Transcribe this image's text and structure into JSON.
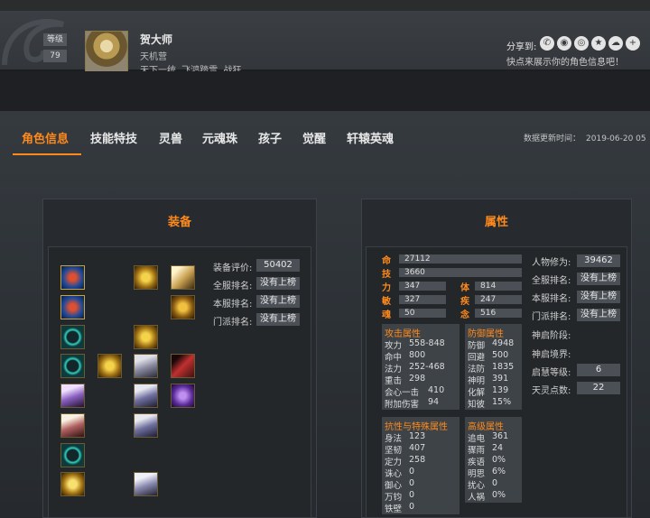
{
  "player": {
    "level_label": "等级",
    "level": "79",
    "name": "贺大师",
    "guild": "天机营",
    "title": "天下一统 飞鸿踏雪 战狂"
  },
  "share": {
    "label": "分享到",
    "subtitle": "快点来展示你的角色信息吧！",
    "icons": [
      "wechat-icon",
      "qq-icon",
      "weibo-icon",
      "qzone-icon",
      "douban-icon",
      "more-icon"
    ]
  },
  "tabs": [
    "角色信息",
    "技能特技",
    "灵兽",
    "元魂珠",
    "孩子",
    "觉醒",
    "轩辕英魂"
  ],
  "update_label": "数据更新时间：",
  "update_value": "2019-06-20 05",
  "equip": {
    "title": "装备",
    "rows": [
      {
        "label": "装备评价:",
        "value": "50402"
      },
      {
        "label": "全服排名:",
        "value": "没有上榜"
      },
      {
        "label": "本服排名:",
        "value": "没有上榜"
      },
      {
        "label": "门派排名:",
        "value": "没有上榜"
      }
    ]
  },
  "attr": {
    "title": "属性",
    "bars": [
      {
        "label": "命",
        "value": "27112"
      },
      {
        "label": "技",
        "value": "3660"
      }
    ],
    "pairs": [
      {
        "l1": "力",
        "v1": "347",
        "l2": "体",
        "v2": "814"
      },
      {
        "l1": "敏",
        "v1": "327",
        "l2": "疾",
        "v2": "247"
      },
      {
        "l1": "魂",
        "v1": "50",
        "l2": "念",
        "v2": "516"
      }
    ],
    "attack": {
      "head": "攻击属性",
      "rows": [
        [
          "攻力",
          "558-848"
        ],
        [
          "命中",
          "800"
        ],
        [
          "法力",
          "252-468"
        ],
        [
          "重击",
          "298"
        ],
        [
          "会心一击",
          "410"
        ],
        [
          "附加伤害",
          "94"
        ]
      ]
    },
    "defense": {
      "head": "防御属性",
      "rows": [
        [
          "防御",
          "4948"
        ],
        [
          "回避",
          "500"
        ],
        [
          "法防",
          "1835"
        ],
        [
          "神明",
          "391"
        ],
        [
          "化解",
          "139"
        ],
        [
          "知彼",
          "15%"
        ]
      ]
    },
    "resist": {
      "head": "抗性与特殊属性",
      "rows": [
        [
          "身法",
          "123"
        ],
        [
          "坚韧",
          "407"
        ],
        [
          "定力",
          "258"
        ],
        [
          "诛心",
          "0"
        ],
        [
          "御心",
          "0"
        ],
        [
          "万钧",
          "0"
        ],
        [
          "铁壁",
          "0"
        ]
      ]
    },
    "advanced": {
      "head": "高级属性",
      "rows": [
        [
          "追电",
          "361"
        ],
        [
          "骤雨",
          "24"
        ],
        [
          "疾语",
          "0%"
        ],
        [
          "明思",
          "6%"
        ],
        [
          "扰心",
          "0"
        ],
        [
          "人祸",
          "0%"
        ]
      ]
    },
    "right": [
      {
        "label": "人物修为:",
        "value": "39462"
      },
      {
        "label": "全服排名:",
        "value": "没有上榜"
      },
      {
        "label": "本服排名:",
        "value": "没有上榜"
      },
      {
        "label": "门派排名:",
        "value": "没有上榜"
      },
      {
        "label": "神启阶段:",
        "value": ""
      },
      {
        "label": "神启境界:",
        "value": ""
      },
      {
        "label": "启慧等级:",
        "value": "6"
      },
      {
        "label": "天灵点数:",
        "value": "22"
      }
    ]
  },
  "colors": {
    "accent": "#ff8a1c",
    "panel": "#272b2f",
    "box": "#4b5056"
  }
}
